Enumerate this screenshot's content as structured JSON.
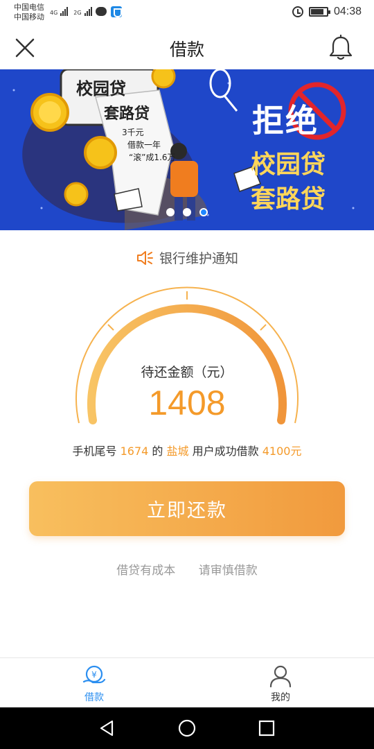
{
  "status_bar": {
    "carrier_1": "中国电信",
    "carrier_2": "中国移动",
    "net_1": "4G",
    "net_2": "2G",
    "time": "04:38",
    "icons": [
      "signal-icon",
      "chat-icon",
      "shield-icon",
      "alarm-icon",
      "battery-icon"
    ]
  },
  "header": {
    "title": "借款",
    "close_icon": "close-icon",
    "bell_icon": "bell-icon"
  },
  "banner": {
    "paper_title_1": "校园贷",
    "paper_title_2": "套路贷",
    "paper_line_1": "3千元",
    "paper_line_2": "借款一年",
    "paper_line_3": "“滚”成1.6万",
    "reject": "拒绝",
    "line_2": "校园贷",
    "line_3": "套路贷",
    "active_dot": 3,
    "dot_count": 3
  },
  "notice": {
    "text": "银行维护通知",
    "icon": "speaker-icon"
  },
  "gauge": {
    "label": "待还金额（元）",
    "amount": "1408"
  },
  "success_line": {
    "prefix": "手机尾号",
    "phone_tail": "1674",
    "middle_1": "的",
    "city": "盐城",
    "middle_2": "用户成功借款",
    "amount": "4100元"
  },
  "repay_button": {
    "label": "立即还款"
  },
  "tips": {
    "tip_1": "借贷有成本",
    "tip_2": "请审慎借款"
  },
  "bottom_nav": {
    "items": [
      {
        "label": "借款",
        "icon": "loan-icon",
        "active": true
      },
      {
        "label": "我的",
        "icon": "user-icon",
        "active": false
      }
    ]
  },
  "colors": {
    "accent_orange": "#f49a2a",
    "active_blue": "#2a8ef0",
    "banner_blue": "#1f47c9"
  }
}
